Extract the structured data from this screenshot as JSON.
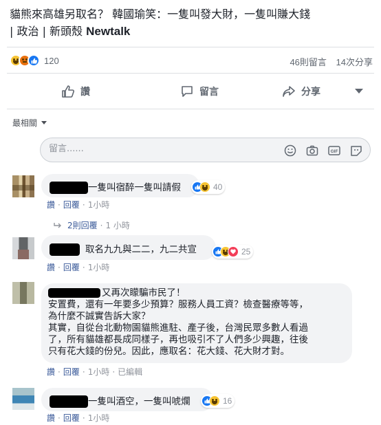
{
  "post": {
    "title_line1": "貓熊來高雄另取名？ 韓國瑜笑：一隻叫發大財，一隻叫賺大錢",
    "title_line2_pre": "| 政治 | 新頭殼 ",
    "title_brand": "Newtalk"
  },
  "reactions": {
    "count": "120",
    "types": [
      "haha",
      "angry",
      "like"
    ]
  },
  "stats": {
    "comments": "46則留言",
    "shares": "14次分享"
  },
  "actions": {
    "like": "讚",
    "comment": "留言",
    "share": "分享"
  },
  "sort": {
    "label": "最相關"
  },
  "composer": {
    "placeholder": "留言......"
  },
  "comments": [
    {
      "text": "一隻叫宿醉一隻叫請假",
      "reaction_count": "40",
      "reaction_types": [
        "like",
        "haha"
      ],
      "like": "讚",
      "reply": "回覆",
      "time": "1小時",
      "replies_label": "2則回覆",
      "replies_time": "1 小時"
    },
    {
      "text": "取名九九與二二，九二共宣",
      "reaction_count": "25",
      "reaction_types": [
        "like",
        "haha",
        "love"
      ],
      "like": "讚",
      "reply": "回覆",
      "time": "1小時"
    },
    {
      "line1": "又再次矇騙市民了！",
      "line2": "安置費，還有一年要多少預算？服務人員工資？檢查醫療等等，",
      "line3": "為什麼不誠實告訴大家？",
      "line4": "其實，自從台北動物園貓熊進駐、產子後，台灣民眾多數人看過",
      "line5": "了，所有貓雄都長成同樣子，再也吸引不了人們多少興趣，往後",
      "line6": "只有花大錢的份兒。因此，應取名：花大錢、花大財才對。",
      "like": "讚",
      "reply": "回覆",
      "time": "1小時",
      "edited": "已編輯"
    },
    {
      "text": "一隻叫酒空，一隻叫唬爛",
      "reaction_count": "16",
      "reaction_types": [
        "like",
        "haha"
      ],
      "like": "讚",
      "reply": "回覆",
      "time": "1小時"
    }
  ],
  "colors": {
    "link": "#385898",
    "like_blue": "#1877f2",
    "muted": "#90949c",
    "bubble": "#f2f3f5"
  }
}
